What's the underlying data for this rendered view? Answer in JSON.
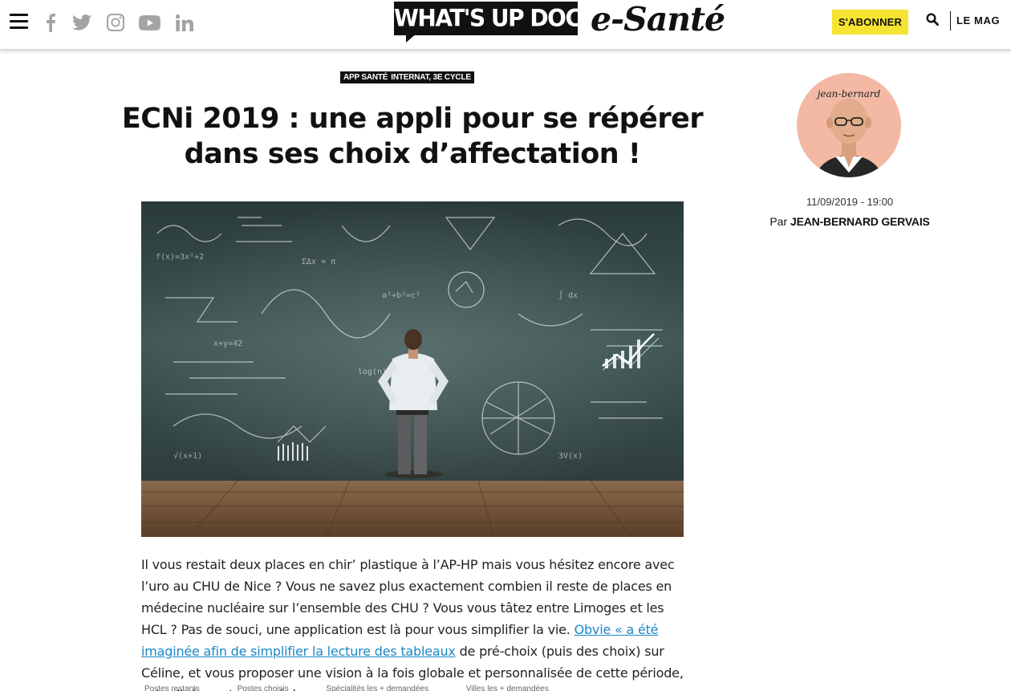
{
  "header": {
    "logo_text": "WHAT'S UP DOC ?",
    "logo_brand": "e-Santé",
    "subscribe_label": "S'ABONNER",
    "mag_label": "LE MAG",
    "social": [
      "facebook-icon",
      "twitter-icon",
      "instagram-icon",
      "youtube-icon",
      "linkedin-icon"
    ]
  },
  "article": {
    "tags": [
      "APP SANTÉ",
      "INTERNAT, 3E CYCLE"
    ],
    "title": "ECNi 2019 : une appli pour se répérer dans ses choix d’affectation !",
    "body_part1": "Il vous restait deux places en chir’ plastique à l’AP-HP mais vous hésitez encore avec l’uro au CHU de Nice ? Vous ne savez plus exactement combien il reste de places en médecine nucléaire sur l’ensemble des CHU ? Vous vous tâtez entre Limoges et les HCL ? Pas de souci, une application est là pour vous simplifier la vie. ",
    "body_link": "Obvie « a été imaginée afin de simplifier la lecture des tableaux",
    "body_part2": " de pré-choix (puis des choix) sur Céline, et vous proposer une vision à la fois globale et personnalisée de cette période, actualisée en temps réel ».",
    "table_peek": [
      "Postes restants",
      "Postes choisis",
      "Spécialités les + demandées",
      "Villes les + demandées"
    ]
  },
  "author": {
    "avatar_label": "jean-bernard",
    "date": "11/09/2019 - 19:00",
    "by_prefix": "Par",
    "name": "JEAN-BERNARD GERVAIS"
  },
  "colors": {
    "accent_yellow": "#f6e332",
    "link_blue": "#1b87c7",
    "avatar_bg": "#f3b9a5"
  }
}
